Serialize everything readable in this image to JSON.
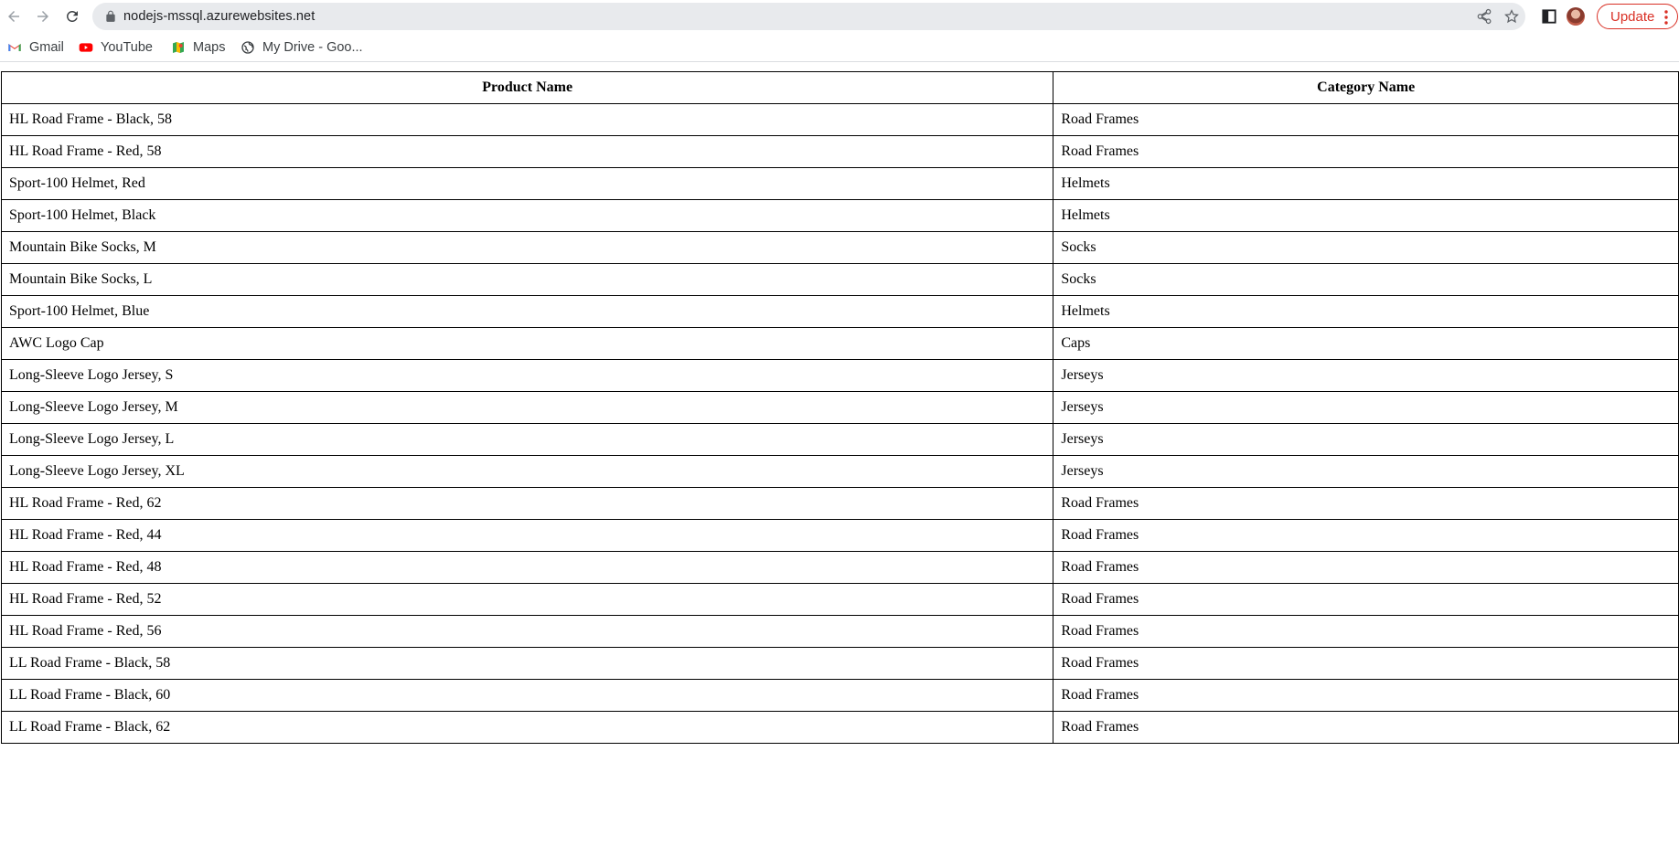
{
  "browser": {
    "url": "nodejs-mssql.azurewebsites.net",
    "update_label": "Update"
  },
  "bookmarks": [
    {
      "label": "Gmail",
      "icon": "gmail-icon"
    },
    {
      "label": "YouTube",
      "icon": "youtube-icon"
    },
    {
      "label": "Maps",
      "icon": "maps-icon"
    },
    {
      "label": "My Drive - Goo...",
      "icon": "globe-icon"
    }
  ],
  "table": {
    "headers": [
      "Product Name",
      "Category Name"
    ],
    "rows": [
      [
        "HL Road Frame - Black, 58",
        "Road Frames"
      ],
      [
        "HL Road Frame - Red, 58",
        "Road Frames"
      ],
      [
        "Sport-100 Helmet, Red",
        "Helmets"
      ],
      [
        "Sport-100 Helmet, Black",
        "Helmets"
      ],
      [
        "Mountain Bike Socks, M",
        "Socks"
      ],
      [
        "Mountain Bike Socks, L",
        "Socks"
      ],
      [
        "Sport-100 Helmet, Blue",
        "Helmets"
      ],
      [
        "AWC Logo Cap",
        "Caps"
      ],
      [
        "Long-Sleeve Logo Jersey, S",
        "Jerseys"
      ],
      [
        "Long-Sleeve Logo Jersey, M",
        "Jerseys"
      ],
      [
        "Long-Sleeve Logo Jersey, L",
        "Jerseys"
      ],
      [
        "Long-Sleeve Logo Jersey, XL",
        "Jerseys"
      ],
      [
        "HL Road Frame - Red, 62",
        "Road Frames"
      ],
      [
        "HL Road Frame - Red, 44",
        "Road Frames"
      ],
      [
        "HL Road Frame - Red, 48",
        "Road Frames"
      ],
      [
        "HL Road Frame - Red, 52",
        "Road Frames"
      ],
      [
        "HL Road Frame - Red, 56",
        "Road Frames"
      ],
      [
        "LL Road Frame - Black, 58",
        "Road Frames"
      ],
      [
        "LL Road Frame - Black, 60",
        "Road Frames"
      ],
      [
        "LL Road Frame - Black, 62",
        "Road Frames"
      ]
    ]
  }
}
